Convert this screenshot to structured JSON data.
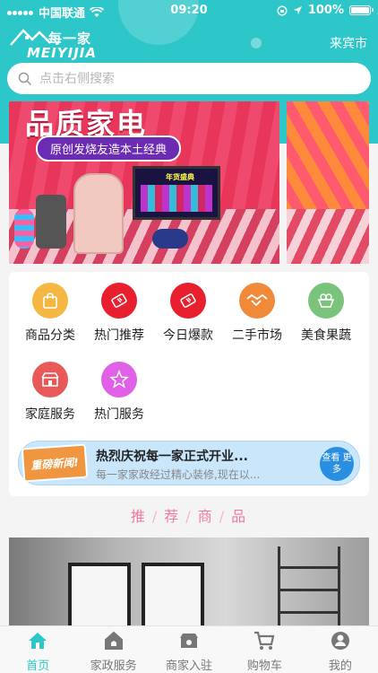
{
  "status_bar": {
    "carrier": "中国联通",
    "time": "09:20",
    "battery": "100%"
  },
  "header": {
    "logo_cn": "每一家",
    "logo_en": "MEIYIJIA",
    "city": "来宾市"
  },
  "search": {
    "placeholder": "点击右侧搜索"
  },
  "banner": {
    "title": "品质家电",
    "subtitle": "原创发烧友造本土经典",
    "tv_text": "年货盛典"
  },
  "categories": [
    {
      "label": "商品分类",
      "icon": "shopping-bag-icon",
      "color": "#f5b642"
    },
    {
      "label": "热门推荐",
      "icon": "ticket-icon",
      "color": "#e8202e"
    },
    {
      "label": "今日爆款",
      "icon": "ticket-icon",
      "color": "#e8202e"
    },
    {
      "label": "二手市场",
      "icon": "handshake-icon",
      "color": "#f08a3a"
    },
    {
      "label": "美食果蔬",
      "icon": "fruit-icon",
      "color": "#79c37a"
    },
    {
      "label": "家庭服务",
      "icon": "store-icon",
      "color": "#e85a5a"
    },
    {
      "label": "热门服务",
      "icon": "star-icon",
      "color": "#e060e8"
    }
  ],
  "notice": {
    "tag": "重磅新闻!",
    "title": "热烈庆祝每一家正式开业...",
    "desc": "每一家家政经过精心装修,现在以...",
    "more_label": "查看 更多"
  },
  "section": {
    "chars": [
      "推",
      "荐",
      "商",
      "品"
    ]
  },
  "tabbar": [
    {
      "label": "首页",
      "icon": "home-icon",
      "active": true
    },
    {
      "label": "家政服务",
      "icon": "house-service-icon",
      "active": false
    },
    {
      "label": "商家入驻",
      "icon": "merchant-icon",
      "active": false
    },
    {
      "label": "购物车",
      "icon": "cart-icon",
      "active": false
    },
    {
      "label": "我的",
      "icon": "user-icon",
      "active": false
    }
  ],
  "colors": {
    "brand": "#2ec7c9",
    "section_title": "#ef7b9c",
    "tab_inactive": "#777777"
  }
}
